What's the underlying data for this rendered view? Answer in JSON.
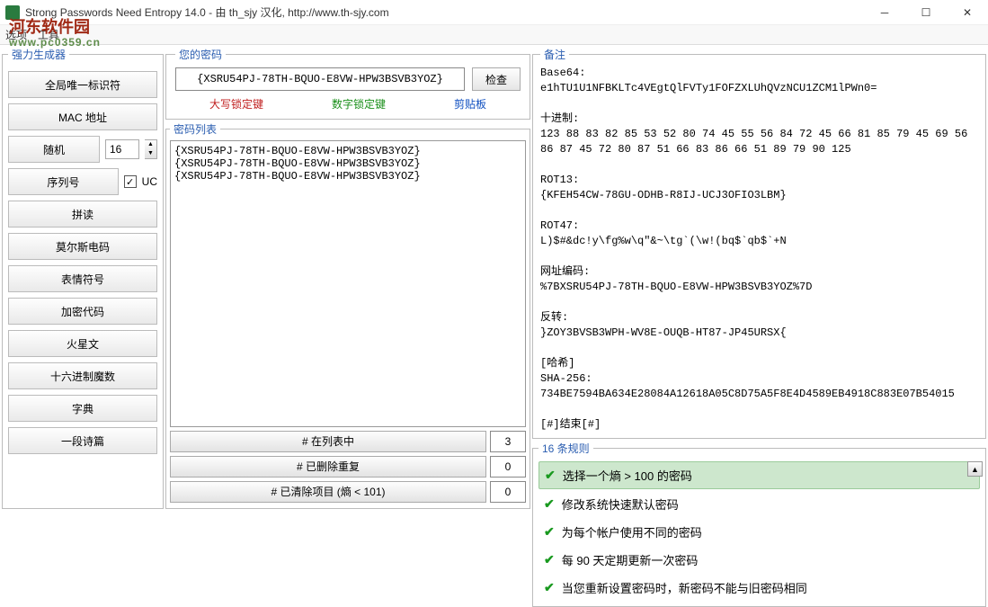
{
  "window": {
    "title": "Strong Passwords Need Entropy 14.0 - 由 th_sjy 汉化, http://www.th-sjy.com"
  },
  "menu": {
    "options": "选项",
    "tools": "工具"
  },
  "watermark": {
    "line1": "河东软件园",
    "line2": "www.pc0359.cn"
  },
  "sidebar": {
    "legend": "强力生成器",
    "guid": "全局唯一标识符",
    "mac": "MAC 地址",
    "random": "随机",
    "random_value": "16",
    "serial": "序列号",
    "uc_label": "UC",
    "uc_checked": "✓",
    "pinyin": "拼读",
    "morse": "莫尔斯电码",
    "emoji": "表情符号",
    "crypto": "加密代码",
    "mars": "火星文",
    "hexmagic": "十六进制魔数",
    "dict": "字典",
    "poem": "一段诗篇"
  },
  "password": {
    "legend": "您的密码",
    "value": "{XSRU54PJ-78TH-BQUO-E8VW-HPW3BSVB3YOZ}",
    "check": "检查",
    "caps": "大写锁定键",
    "num": "数字锁定键",
    "clip": "剪贴板"
  },
  "pwlist": {
    "legend": "密码列表",
    "items": "{XSRU54PJ-78TH-BQUO-E8VW-HPW3BSVB3YOZ}\n{XSRU54PJ-78TH-BQUO-E8VW-HPW3BSVB3YOZ}\n{XSRU54PJ-78TH-BQUO-E8VW-HPW3BSVB3YOZ}",
    "stat_inlist": "# 在列表中",
    "stat_inlist_n": "3",
    "stat_dupes": "# 已删除重复",
    "stat_dupes_n": "0",
    "stat_cleared": "# 已清除项目 (熵 < 101)",
    "stat_cleared_n": "0"
  },
  "notes": {
    "legend": "备注",
    "text": "Base64:\ne1hTU1U1NFBKLTc4VEgtQlFVTy1FOFZXLUhQVzNCU1ZCM1lPWn0=\n\n十进制:\n123 88 83 82 85 53 52 80 74 45 55 56 84 72 45 66 81 85 79 45 69 56 86 87 45 72 80 87 51 66 83 86 66 51 89 79 90 125\n\nROT13:\n{KFEH54CW-78GU-ODHB-R8IJ-UCJ3OFIO3LBM}\n\nROT47:\nL)$#&dc!y\\fg%w\\q\"&~\\tg`(\\w!(bq$`qb$`+N\n\n网址编码:\n%7BXSRU54PJ-78TH-BQUO-E8VW-HPW3BSVB3YOZ%7D\n\n反转:\n}ZOY3BVSB3WPH-WV8E-OUQB-HT87-JP45URSX{\n\n[哈希]\nSHA-256:\n734BE7594BA634E28084A12618A05C8D75A5F8E4D4589EB4918C883E07B54015\n\n[#]结束[#]"
  },
  "rules": {
    "legend": "16 条规则",
    "r1": "选择一个熵 > 100 的密码",
    "r2": "修改系统快速默认密码",
    "r3": "为每个帐户使用不同的密码",
    "r4": "每 90 天定期更新一次密码",
    "r5": "当您重新设置密码时，新密码不能与旧密码相同"
  }
}
